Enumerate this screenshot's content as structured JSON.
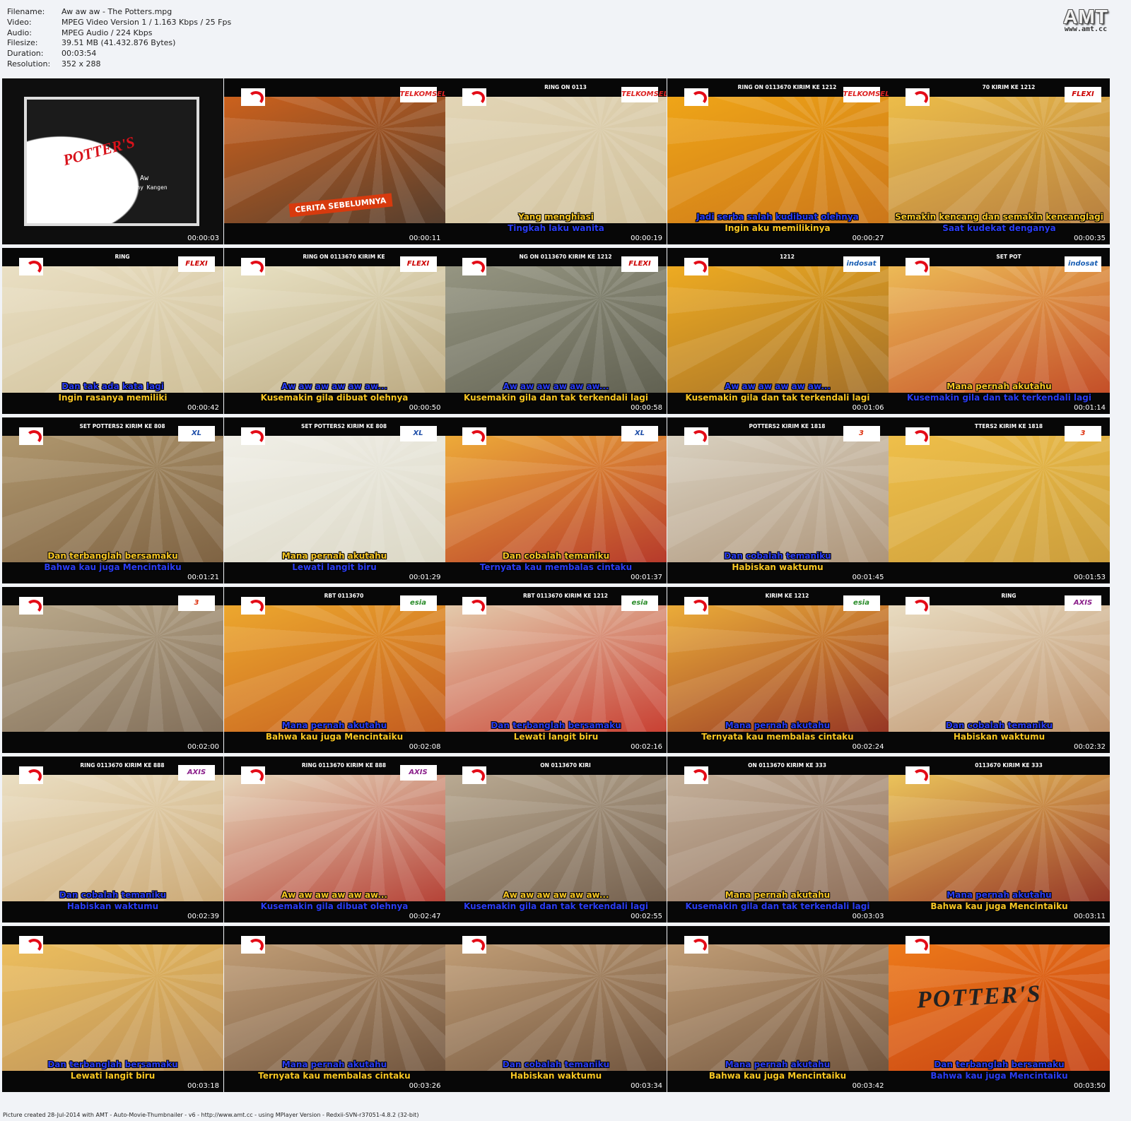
{
  "info": [
    {
      "k": "Filename:",
      "v": "Aw aw aw - The Potters.mpg"
    },
    {
      "k": "Video:",
      "v": "MPEG Video Version 1 / 1.163 Kbps / 25 Fps"
    },
    {
      "k": "Audio:",
      "v": "MPEG Audio / 224 Kbps"
    },
    {
      "k": "Filesize:",
      "v": "39.51 MB (41.432.876 Bytes)"
    },
    {
      "k": "Duration:",
      "v": "00:03:54"
    },
    {
      "k": "Resolution:",
      "v": "352 x 288"
    }
  ],
  "logo": {
    "big": "AMT",
    "small": "www.amt.cc"
  },
  "intro": {
    "title": "POTTER'S",
    "song": "Aw Aw",
    "credit": "Cipt. Dodhy Kangen"
  },
  "cerita": "CERITA SEBELUMNYA",
  "end_title": "POTTER'S",
  "footer": "Picture created 28-Jul-2014 with AMT - Auto-Movie-Thumbnailer - v6 - http://www.amt.cc - using MPlayer Version - Redxii-SVN-r37051-4.8.2 (32-bit)",
  "tiles": [
    {
      "ts": "00:00:03",
      "intro": true,
      "colors": [
        "#111",
        "#111"
      ]
    },
    {
      "ts": "00:00:11",
      "ticker": "",
      "op": "TELKOMSEL",
      "opColor": "#d22",
      "cerita": true,
      "colors": [
        "#d6641b",
        "#4a3b30"
      ],
      "l1": "",
      "l2": ""
    },
    {
      "ts": "00:00:19",
      "ticker": "RING ON 0113",
      "op": "TELKOMSEL",
      "opColor": "#d22",
      "colors": [
        "#e4d7b8",
        "#cfbf9a"
      ],
      "l1": "Yang menghiasi",
      "c1": "y",
      "l2": "Tingkah laku wanita",
      "c2": "b"
    },
    {
      "ts": "00:00:27",
      "ticker": "RING ON 0113670 KIRIM KE 1212",
      "op": "TELKOMSEL",
      "opColor": "#d22",
      "colors": [
        "#f2a917",
        "#c8721a"
      ],
      "l1": "Jadi serba salah kudibuat olehnya",
      "c1": "b",
      "l2": "Ingin aku memilikinya",
      "c2": "y"
    },
    {
      "ts": "00:00:35",
      "ticker": "70 KIRIM KE 1212",
      "op": "FLEXI",
      "opColor": "#c00",
      "colors": [
        "#f1c24a",
        "#b27a3f"
      ],
      "l1": "Semakin kencang dan semakin kencanglagi",
      "c1": "y",
      "l2": "Saat kudekat denganya",
      "c2": "b"
    },
    {
      "ts": "00:00:42",
      "ticker": "RING",
      "op": "FLEXI",
      "opColor": "#c00",
      "colors": [
        "#ece2c7",
        "#cdbd95"
      ],
      "l1": "Dan tak ada kata lagi",
      "c1": "b",
      "l2": "Ingin rasanya memiliki",
      "c2": "y"
    },
    {
      "ts": "00:00:50",
      "ticker": "RING ON 0113670 KIRIM KE",
      "op": "FLEXI",
      "opColor": "#c00",
      "colors": [
        "#ece6c9",
        "#b8a57c"
      ],
      "l1": "Aw aw aw aw aw aw...",
      "c1": "b",
      "l2": "Kusemakin gila dibuat olehnya",
      "c2": "y"
    },
    {
      "ts": "00:00:58",
      "ticker": "NG ON 0113670 KIRIM KE 1212",
      "op": "FLEXI",
      "opColor": "#c00",
      "colors": [
        "#9a9a86",
        "#5c5c4d"
      ],
      "l1": "Aw aw aw aw aw aw...",
      "c1": "b",
      "l2": "Kusemakin gila dan tak terkendali lagi",
      "c2": "y"
    },
    {
      "ts": "00:01:06",
      "ticker": "1212",
      "op": "indosat",
      "opColor": "#1a5fb4",
      "colors": [
        "#f4b021",
        "#9c6a2a"
      ],
      "l1": "Aw aw aw aw aw aw...",
      "c1": "b",
      "l2": "Kusemakin gila dan tak terkendali lagi",
      "c2": "y"
    },
    {
      "ts": "00:01:14",
      "ticker": "SET POT",
      "op": "indosat",
      "opColor": "#1a5fb4",
      "colors": [
        "#f0c35a",
        "#c04424"
      ],
      "l1": "Mana pernah akutahu",
      "c1": "y",
      "l2": "Kusemakin gila dan tak terkendali lagi",
      "c2": "b"
    },
    {
      "ts": "00:01:21",
      "ticker": "SET POTTERS2 KIRIM KE 808",
      "op": "XL",
      "opColor": "#1e4ea8",
      "colors": [
        "#b49c72",
        "#7a5e3f"
      ],
      "l1": "Dan terbanglah bersamaku",
      "c1": "y",
      "l2": "Bahwa kau juga Mencintaiku",
      "c2": "b"
    },
    {
      "ts": "00:01:29",
      "ticker": "SET POTTERS2 KIRIM KE 808",
      "op": "XL",
      "opColor": "#1e4ea8",
      "colors": [
        "#f2f1ea",
        "#d9d5c2"
      ],
      "l1": "Mana pernah akutahu",
      "c1": "y",
      "l2": "Lewati langit biru",
      "c2": "b"
    },
    {
      "ts": "00:01:37",
      "ticker": "",
      "op": "XL",
      "opColor": "#1e4ea8",
      "colors": [
        "#f2b43a",
        "#b12f2a"
      ],
      "l1": "Dan cobalah temaniku",
      "c1": "y",
      "l2": "Ternyata kau membalas cintaku",
      "c2": "b"
    },
    {
      "ts": "00:01:45",
      "ticker": "POTTERS2 KIRIM KE 1818",
      "op": "3",
      "opColor": "#d31",
      "colors": [
        "#ddd6c6",
        "#a98f73"
      ],
      "l1": "Dan cobalah temaniku",
      "c1": "b",
      "l2": "Habiskan waktumu",
      "c2": "y"
    },
    {
      "ts": "00:01:53",
      "ticker": "TTERS2 KIRIM KE 1818",
      "op": "3",
      "opColor": "#d31",
      "colors": [
        "#f2c24b",
        "#c89a3a"
      ],
      "l1": "",
      "l2": ""
    },
    {
      "ts": "00:02:00",
      "ticker": "",
      "op": "3",
      "opColor": "#d31",
      "colors": [
        "#bfae8f",
        "#7d6a56"
      ],
      "l1": "",
      "l2": ""
    },
    {
      "ts": "00:02:08",
      "ticker": "RBT 0113670",
      "op": "esia",
      "opColor": "#2a8c2a",
      "colors": [
        "#f0ae2f",
        "#c0551e"
      ],
      "l1": "Mana pernah akutahu",
      "c1": "b",
      "l2": "Bahwa kau juga Mencintaiku",
      "c2": "y"
    },
    {
      "ts": "00:02:16",
      "ticker": "RBT 0113670 KIRIM KE 1212",
      "op": "esia",
      "opColor": "#2a8c2a",
      "colors": [
        "#e6d6b6",
        "#c63327"
      ],
      "l1": "Dan terbanglah bersamaku",
      "c1": "b",
      "l2": "Lewati langit biru",
      "c2": "y"
    },
    {
      "ts": "00:02:24",
      "ticker": "KIRIM KE 1212",
      "op": "esia",
      "opColor": "#2a8c2a",
      "colors": [
        "#f2b63b",
        "#8e2b22"
      ],
      "l1": "Mana pernah akutahu",
      "c1": "b",
      "l2": "Ternyata kau membalas cintaku",
      "c2": "y"
    },
    {
      "ts": "00:02:32",
      "ticker": "RING",
      "op": "AXIS",
      "opColor": "#8a1e8a",
      "colors": [
        "#ece2c8",
        "#b88a63"
      ],
      "l1": "Dan cobalah temaniku",
      "c1": "b",
      "l2": "Habiskan waktumu",
      "c2": "y"
    },
    {
      "ts": "00:02:39",
      "ticker": "RING 0113670 KIRIM KE 888",
      "op": "AXIS",
      "opColor": "#8a1e8a",
      "colors": [
        "#ede3c9",
        "#c9a570"
      ],
      "l1": "Dan cobalah temaniku",
      "c1": "b",
      "l2": "Habiskan waktumu",
      "c2": "b"
    },
    {
      "ts": "00:02:47",
      "ticker": "RING 0113670 KIRIM KE 888",
      "op": "AXIS",
      "opColor": "#8a1e8a",
      "colors": [
        "#ebe3c6",
        "#b1352b"
      ],
      "l1": "Aw aw aw aw aw aw...",
      "c1": "y",
      "l2": "Kusemakin gila dibuat olehnya",
      "c2": "b"
    },
    {
      "ts": "00:02:55",
      "ticker": "ON 0113670 KIRI",
      "op": "",
      "opColor": "#000",
      "colors": [
        "#bfb098",
        "#6f5a48"
      ],
      "l1": "Aw aw aw aw aw aw...",
      "c1": "y",
      "l2": "Kusemakin gila dan tak terkendali lagi",
      "c2": "b"
    },
    {
      "ts": "00:03:03",
      "ticker": "ON 0113670 KIRIM KE 333",
      "op": "",
      "opColor": "#000",
      "colors": [
        "#c9b6a0",
        "#8a6a55"
      ],
      "l1": "Mana pernah akutahu",
      "c1": "y",
      "l2": "Kusemakin gila dan tak terkendali lagi",
      "c2": "b"
    },
    {
      "ts": "00:03:11",
      "ticker": "0113670 KIRIM KE 333",
      "op": "",
      "opColor": "#000",
      "colors": [
        "#f2cf5f",
        "#8e2a22"
      ],
      "l1": "Mana pernah akutahu",
      "c1": "b",
      "l2": "Bahwa kau juga Mencintaiku",
      "c2": "y"
    },
    {
      "ts": "00:03:18",
      "ticker": "",
      "op": "",
      "opColor": "#000",
      "colors": [
        "#f1c25d",
        "#b68d5b"
      ],
      "l1": "Dan terbanglah bersamaku",
      "c1": "b",
      "l2": "Lewati langit biru",
      "c2": "y"
    },
    {
      "ts": "00:03:26",
      "ticker": "",
      "op": "",
      "opColor": "#000",
      "colors": [
        "#c7a37a",
        "#6a4f3a"
      ],
      "l1": "Mana pernah akutahu",
      "c1": "b",
      "l2": "Ternyata kau membalas cintaku",
      "c2": "y"
    },
    {
      "ts": "00:03:34",
      "ticker": "",
      "op": "",
      "opColor": "#000",
      "colors": [
        "#c7a37a",
        "#6a4f3a"
      ],
      "l1": "Dan cobalah temaniku",
      "c1": "b",
      "l2": "Habiskan waktumu",
      "c2": "y"
    },
    {
      "ts": "00:03:42",
      "ticker": "",
      "op": "",
      "opColor": "#000",
      "colors": [
        "#c7a37a",
        "#6a4f3a"
      ],
      "l1": "Mana pernah akutahu",
      "c1": "b",
      "l2": "Bahwa kau juga Mencintaiku",
      "c2": "y"
    },
    {
      "ts": "00:03:50",
      "ticker": "",
      "op": "",
      "opColor": "#000",
      "end": true,
      "colors": [
        "#f07e1a",
        "#c23b12"
      ],
      "l1": "Dan terbanglah bersamaku",
      "c1": "b",
      "l2": "Bahwa kau juga Mencintaiku",
      "c2": "b"
    }
  ]
}
